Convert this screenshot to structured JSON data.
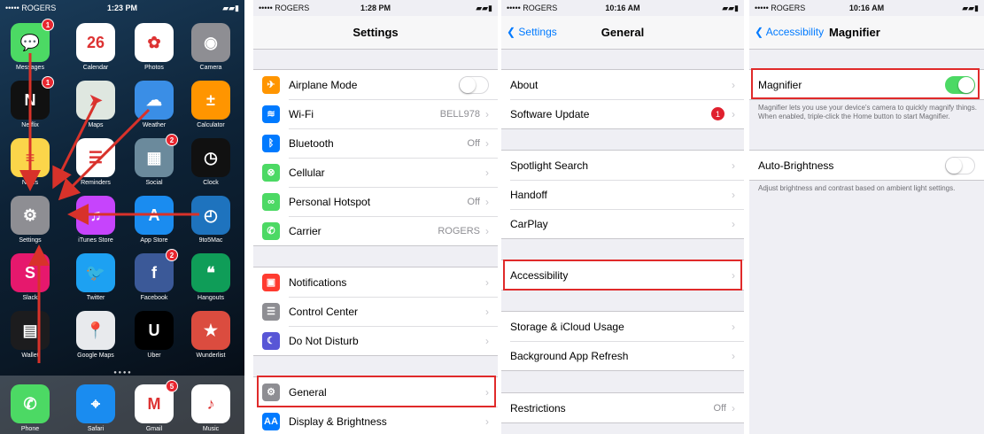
{
  "home": {
    "status": {
      "carrier": "••••• ROGERS",
      "time": "1:23 PM"
    },
    "apps": [
      {
        "name": "Messages",
        "icon": "messages-icon",
        "color": "#4cd964",
        "glyph": "💬",
        "badge": "1"
      },
      {
        "name": "Calendar",
        "icon": "calendar-icon",
        "color": "#ffffff",
        "glyph": "26",
        "badge": ""
      },
      {
        "name": "Photos",
        "icon": "photos-icon",
        "color": "#ffffff",
        "glyph": "✿",
        "badge": ""
      },
      {
        "name": "Camera",
        "icon": "camera-icon",
        "color": "#8e8e93",
        "glyph": "◉",
        "badge": ""
      },
      {
        "name": "Netflix",
        "icon": "netflix-icon",
        "color": "#111111",
        "glyph": "N",
        "badge": "1"
      },
      {
        "name": "Maps",
        "icon": "maps-icon",
        "color": "#dfe7e0",
        "glyph": "➤",
        "badge": ""
      },
      {
        "name": "Weather",
        "icon": "weather-icon",
        "color": "#3a8ee6",
        "glyph": "☁",
        "badge": ""
      },
      {
        "name": "Calculator",
        "icon": "calculator-icon",
        "color": "#ff9500",
        "glyph": "±",
        "badge": ""
      },
      {
        "name": "Notes",
        "icon": "notes-icon",
        "color": "#fbd54a",
        "glyph": "≡",
        "badge": ""
      },
      {
        "name": "Reminders",
        "icon": "reminders-icon",
        "color": "#ffffff",
        "glyph": "☰",
        "badge": ""
      },
      {
        "name": "Social",
        "icon": "social-folder-icon",
        "color": "#6b8a9c",
        "glyph": "▦",
        "badge": "2"
      },
      {
        "name": "Clock",
        "icon": "clock-icon",
        "color": "#111111",
        "glyph": "◷",
        "badge": ""
      },
      {
        "name": "Settings",
        "icon": "settings-icon",
        "color": "#8e8e93",
        "glyph": "⚙",
        "badge": ""
      },
      {
        "name": "iTunes Store",
        "icon": "itunes-store-icon",
        "color": "#c644fc",
        "glyph": "♫",
        "badge": ""
      },
      {
        "name": "App Store",
        "icon": "app-store-icon",
        "color": "#1a8cf0",
        "glyph": "A",
        "badge": ""
      },
      {
        "name": "9to5Mac",
        "icon": "9to5mac-icon",
        "color": "#1e73be",
        "glyph": "◴",
        "badge": ""
      },
      {
        "name": "Slack",
        "icon": "slack-icon",
        "color": "#e6186d",
        "glyph": "S",
        "badge": ""
      },
      {
        "name": "Twitter",
        "icon": "twitter-icon",
        "color": "#1da1f2",
        "glyph": "🐦",
        "badge": ""
      },
      {
        "name": "Facebook",
        "icon": "facebook-icon",
        "color": "#3b5998",
        "glyph": "f",
        "badge": "2"
      },
      {
        "name": "Hangouts",
        "icon": "hangouts-icon",
        "color": "#0f9d58",
        "glyph": "❝",
        "badge": ""
      },
      {
        "name": "Wallet",
        "icon": "wallet-icon",
        "color": "#1c1c1e",
        "glyph": "▤",
        "badge": ""
      },
      {
        "name": "Google Maps",
        "icon": "google-maps-icon",
        "color": "#e8eaed",
        "glyph": "📍",
        "badge": ""
      },
      {
        "name": "Uber",
        "icon": "uber-icon",
        "color": "#000000",
        "glyph": "U",
        "badge": ""
      },
      {
        "name": "Wunderlist",
        "icon": "wunderlist-icon",
        "color": "#db4c3f",
        "glyph": "★",
        "badge": ""
      }
    ],
    "dock": [
      {
        "name": "Phone",
        "icon": "phone-icon",
        "color": "#4cd964",
        "glyph": "✆",
        "badge": ""
      },
      {
        "name": "Safari",
        "icon": "safari-icon",
        "color": "#1a8cf0",
        "glyph": "⌖",
        "badge": ""
      },
      {
        "name": "Gmail",
        "icon": "gmail-icon",
        "color": "#ffffff",
        "glyph": "M",
        "badge": "5"
      },
      {
        "name": "Music",
        "icon": "music-icon",
        "color": "#ffffff",
        "glyph": "♪",
        "badge": ""
      }
    ]
  },
  "settings": {
    "status": {
      "carrier": "••••• ROGERS",
      "time": "1:28 PM"
    },
    "title": "Settings",
    "groups": [
      [
        {
          "label": "Airplane Mode",
          "icon": "airplane-icon",
          "color": "#ff9500",
          "glyph": "✈",
          "detail": "",
          "toggle": "off"
        },
        {
          "label": "Wi-Fi",
          "icon": "wifi-icon",
          "color": "#007aff",
          "glyph": "≋",
          "detail": "BELL978",
          "toggle": ""
        },
        {
          "label": "Bluetooth",
          "icon": "bluetooth-icon",
          "color": "#007aff",
          "glyph": "ᛒ",
          "detail": "Off",
          "toggle": ""
        },
        {
          "label": "Cellular",
          "icon": "cellular-icon",
          "color": "#4cd964",
          "glyph": "⊗",
          "detail": "",
          "toggle": ""
        },
        {
          "label": "Personal Hotspot",
          "icon": "hotspot-icon",
          "color": "#4cd964",
          "glyph": "∞",
          "detail": "Off",
          "toggle": ""
        },
        {
          "label": "Carrier",
          "icon": "carrier-icon",
          "color": "#4cd964",
          "glyph": "✆",
          "detail": "ROGERS",
          "toggle": ""
        }
      ],
      [
        {
          "label": "Notifications",
          "icon": "notifications-icon",
          "color": "#ff3b30",
          "glyph": "▣",
          "detail": "",
          "toggle": ""
        },
        {
          "label": "Control Center",
          "icon": "control-center-icon",
          "color": "#8e8e93",
          "glyph": "☰",
          "detail": "",
          "toggle": ""
        },
        {
          "label": "Do Not Disturb",
          "icon": "do-not-disturb-icon",
          "color": "#5856d6",
          "glyph": "☾",
          "detail": "",
          "toggle": ""
        }
      ],
      [
        {
          "label": "General",
          "icon": "general-gear-icon",
          "color": "#8e8e93",
          "glyph": "⚙",
          "detail": "",
          "toggle": ""
        },
        {
          "label": "Display & Brightness",
          "icon": "display-brightness-icon",
          "color": "#007aff",
          "glyph": "AA",
          "detail": "",
          "toggle": ""
        }
      ]
    ]
  },
  "general": {
    "status": {
      "carrier": "••••• ROGERS",
      "time": "10:16 AM"
    },
    "back": "Settings",
    "title": "General",
    "groups": [
      [
        {
          "label": "About",
          "detail": "",
          "badge": ""
        },
        {
          "label": "Software Update",
          "detail": "",
          "badge": "1"
        }
      ],
      [
        {
          "label": "Spotlight Search",
          "detail": "",
          "badge": ""
        },
        {
          "label": "Handoff",
          "detail": "",
          "badge": ""
        },
        {
          "label": "CarPlay",
          "detail": "",
          "badge": ""
        }
      ],
      [
        {
          "label": "Accessibility",
          "detail": "",
          "badge": ""
        }
      ],
      [
        {
          "label": "Storage & iCloud Usage",
          "detail": "",
          "badge": ""
        },
        {
          "label": "Background App Refresh",
          "detail": "",
          "badge": ""
        }
      ],
      [
        {
          "label": "Restrictions",
          "detail": "Off",
          "badge": ""
        }
      ]
    ]
  },
  "magnifier": {
    "status": {
      "carrier": "••••• ROGERS",
      "time": "10:16 AM"
    },
    "back": "Accessibility",
    "title": "Magnifier",
    "magnifier_label": "Magnifier",
    "magnifier_toggle": "on",
    "magnifier_note": "Magnifier lets you use your device's camera to quickly magnify things. When enabled, triple-click the Home button to start Magnifier.",
    "auto_label": "Auto-Brightness",
    "auto_toggle": "off",
    "auto_note": "Adjust brightness and contrast based on ambient light settings."
  },
  "colors": {
    "highlight": "#e02a2a",
    "ios_blue": "#007aff",
    "toggle_on": "#4cd964",
    "arrow": "#d8322a"
  }
}
